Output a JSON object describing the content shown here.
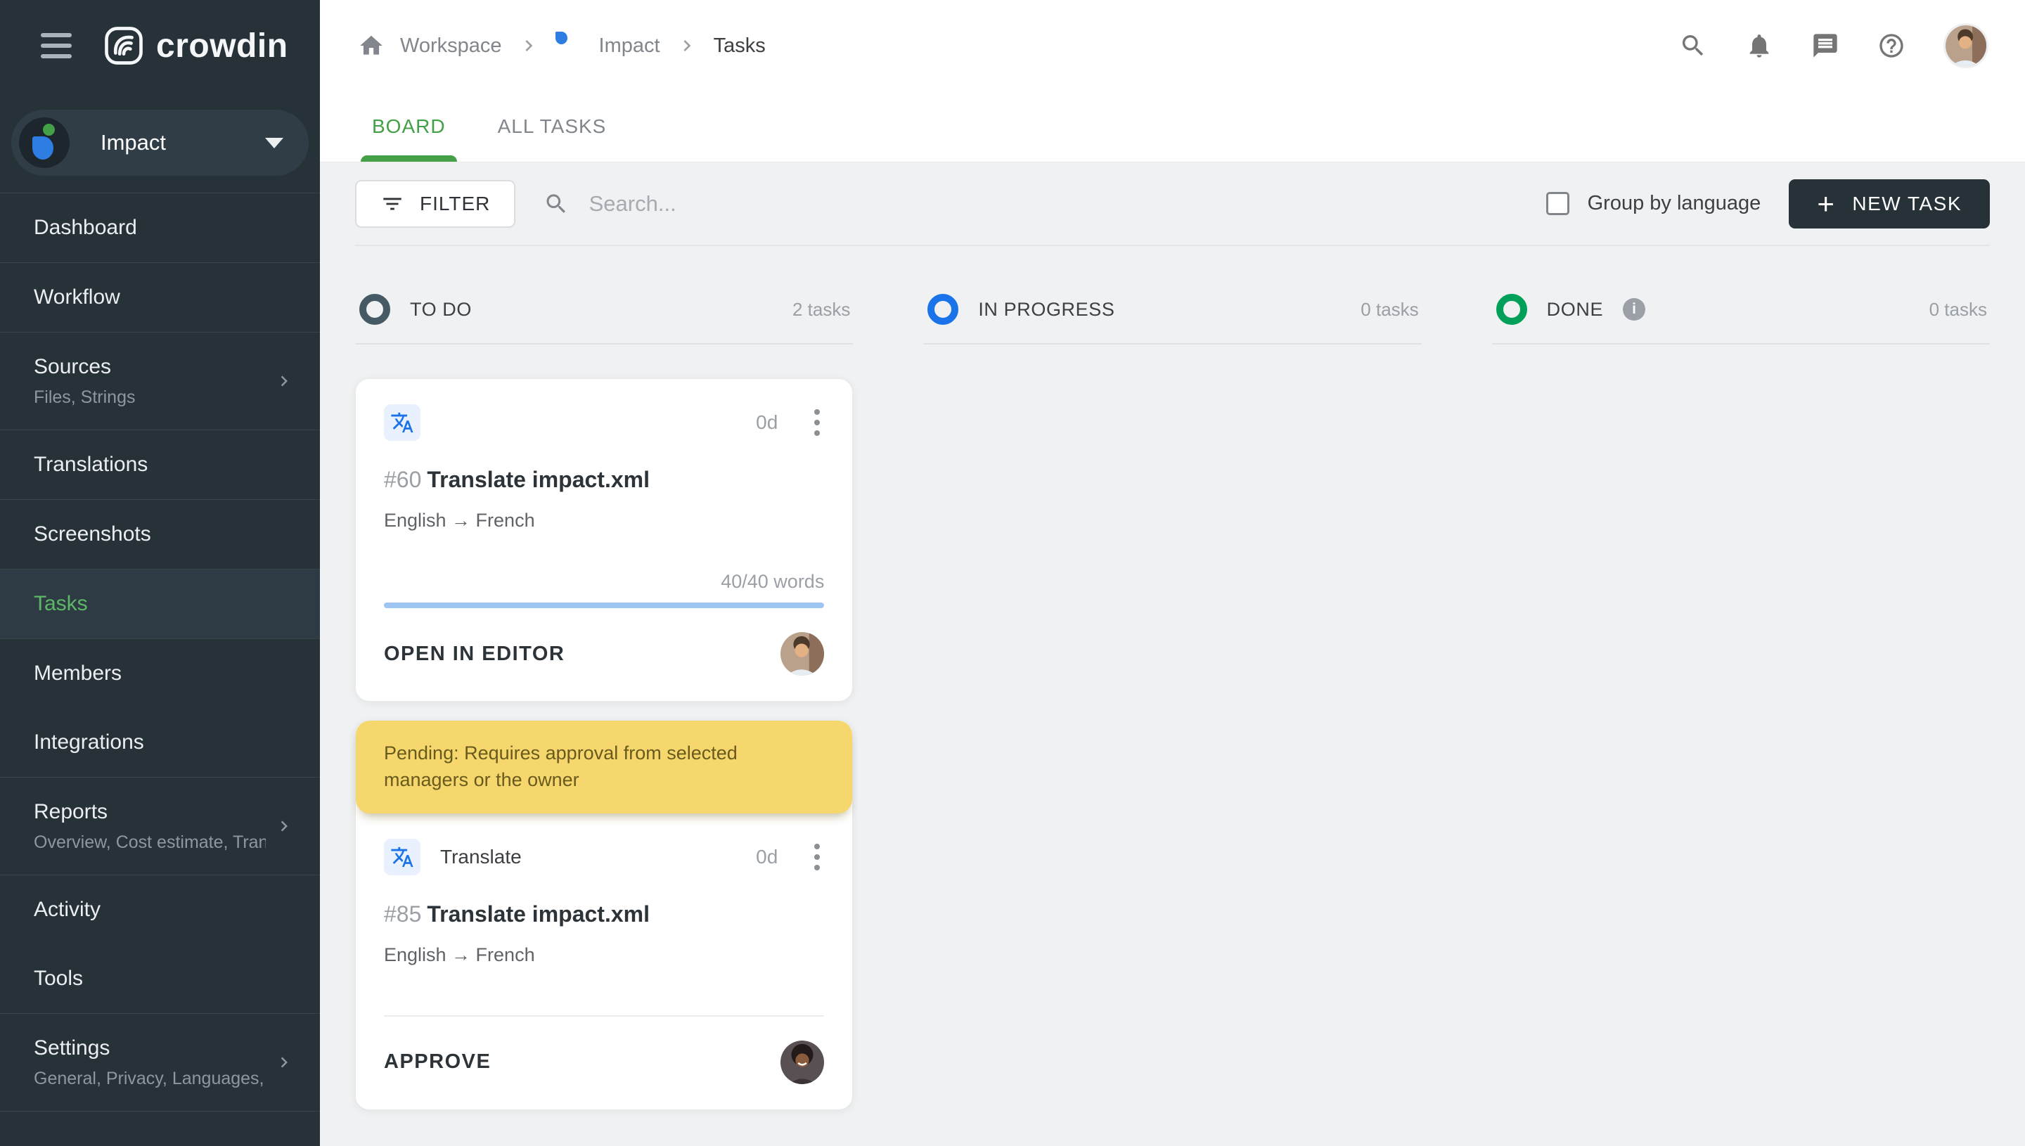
{
  "app": {
    "brand": "crowdin"
  },
  "sidebar": {
    "project": {
      "name": "Impact"
    },
    "items": [
      {
        "label": "Dashboard"
      },
      {
        "label": "Workflow"
      },
      {
        "label": "Sources",
        "subtitle": "Files, Strings"
      },
      {
        "label": "Translations"
      },
      {
        "label": "Screenshots"
      },
      {
        "label": "Tasks"
      },
      {
        "label": "Members"
      },
      {
        "label": "Integrations"
      },
      {
        "label": "Reports",
        "subtitle": "Overview, Cost estimate, Transl…"
      },
      {
        "label": "Activity"
      },
      {
        "label": "Tools"
      },
      {
        "label": "Settings",
        "subtitle": "General, Privacy, Languages, Q…"
      }
    ]
  },
  "breadcrumb": {
    "workspace": "Workspace",
    "project": "Impact",
    "current": "Tasks"
  },
  "tabs": {
    "board": "BOARD",
    "all_tasks": "ALL TASKS"
  },
  "toolbar": {
    "filter": "FILTER",
    "search_placeholder": "Search...",
    "group_by": "Group by language",
    "new_task": "NEW TASK"
  },
  "board": {
    "columns": [
      {
        "title": "TO DO",
        "count": "2 tasks",
        "ring_style": "border-color:#455a64"
      },
      {
        "title": "IN PROGRESS",
        "count": "0 tasks",
        "ring_style": "border-color:#1a73e8"
      },
      {
        "title": "DONE",
        "count": "0 tasks",
        "ring_style": "border-color:#00a05a"
      }
    ],
    "cards": [
      {
        "id": "#60",
        "title": "Translate impact.xml",
        "languages": "English → French",
        "duration": "0d",
        "words": "40/40 words",
        "action": "OPEN IN EDITOR",
        "progress_style": "width:100%;background:#9ec4f3"
      },
      {
        "banner": "Pending: Requires approval from selected managers or the owner",
        "type": "Translate",
        "id": "#85",
        "title": "Translate impact.xml",
        "languages": "English → French",
        "duration": "0d",
        "action": "APPROVE"
      }
    ]
  },
  "icons": {
    "plus": "+",
    "info": "i"
  },
  "colors": {
    "sidebar_bg": "#263238",
    "active_item_green": "#5cb865",
    "tab_green": "#43a047",
    "todo_ring": "#455a64",
    "in_progress_ring": "#1a73e8",
    "done_ring": "#00a05a",
    "banner_bg": "#f5d76d",
    "banner_text": "#695a1d",
    "progress_blue": "#9ec4f3",
    "new_task_bg": "#263238",
    "task_icon_blue": "#1a73e8"
  }
}
